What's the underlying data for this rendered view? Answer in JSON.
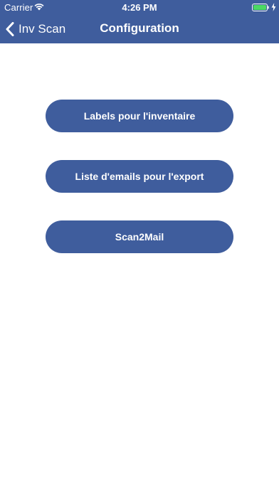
{
  "status_bar": {
    "carrier": "Carrier",
    "time": "4:26 PM",
    "wifi_icon": "wifi-icon",
    "battery_icon": "battery-icon",
    "charging_icon": "charging-bolt-icon",
    "battery_color": "#4cd964"
  },
  "nav_bar": {
    "back_label": "Inv Scan",
    "back_icon": "chevron-left-icon",
    "title": "Configuration"
  },
  "menu": {
    "labels_button": "Labels pour l'inventaire",
    "emails_button": "Liste d'emails pour l'export",
    "scan2mail_button": "Scan2Mail"
  },
  "colors": {
    "brand": "#3f5d9d",
    "background": "#ffffff",
    "text_on_brand": "#ffffff"
  }
}
